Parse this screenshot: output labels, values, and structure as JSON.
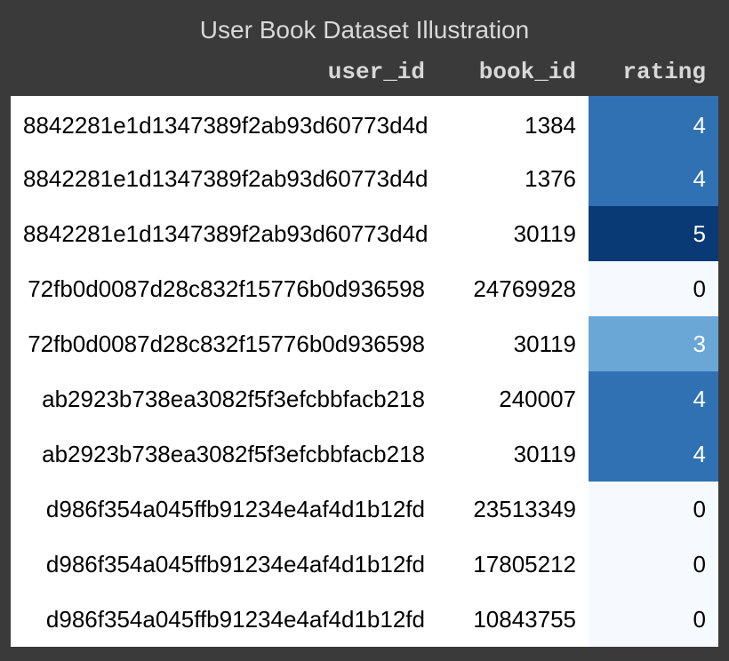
{
  "title": "User Book Dataset Illustration",
  "columns": {
    "user_id": "user_id",
    "book_id": "book_id",
    "rating": "rating"
  },
  "rating_colors": {
    "0": "#f6f9fd",
    "3": "#6aa7d6",
    "4": "#2f71b3",
    "5": "#0a3a75"
  },
  "rows": [
    {
      "user_id": "8842281e1d1347389f2ab93d60773d4d",
      "book_id": "1384",
      "rating": 4
    },
    {
      "user_id": "8842281e1d1347389f2ab93d60773d4d",
      "book_id": "1376",
      "rating": 4
    },
    {
      "user_id": "8842281e1d1347389f2ab93d60773d4d",
      "book_id": "30119",
      "rating": 5
    },
    {
      "user_id": "72fb0d0087d28c832f15776b0d936598",
      "book_id": "24769928",
      "rating": 0
    },
    {
      "user_id": "72fb0d0087d28c832f15776b0d936598",
      "book_id": "30119",
      "rating": 3
    },
    {
      "user_id": "ab2923b738ea3082f5f3efcbbfacb218",
      "book_id": "240007",
      "rating": 4
    },
    {
      "user_id": "ab2923b738ea3082f5f3efcbbfacb218",
      "book_id": "30119",
      "rating": 4
    },
    {
      "user_id": "d986f354a045ffb91234e4af4d1b12fd",
      "book_id": "23513349",
      "rating": 0
    },
    {
      "user_id": "d986f354a045ffb91234e4af4d1b12fd",
      "book_id": "17805212",
      "rating": 0
    },
    {
      "user_id": "d986f354a045ffb91234e4af4d1b12fd",
      "book_id": "10843755",
      "rating": 0
    }
  ]
}
